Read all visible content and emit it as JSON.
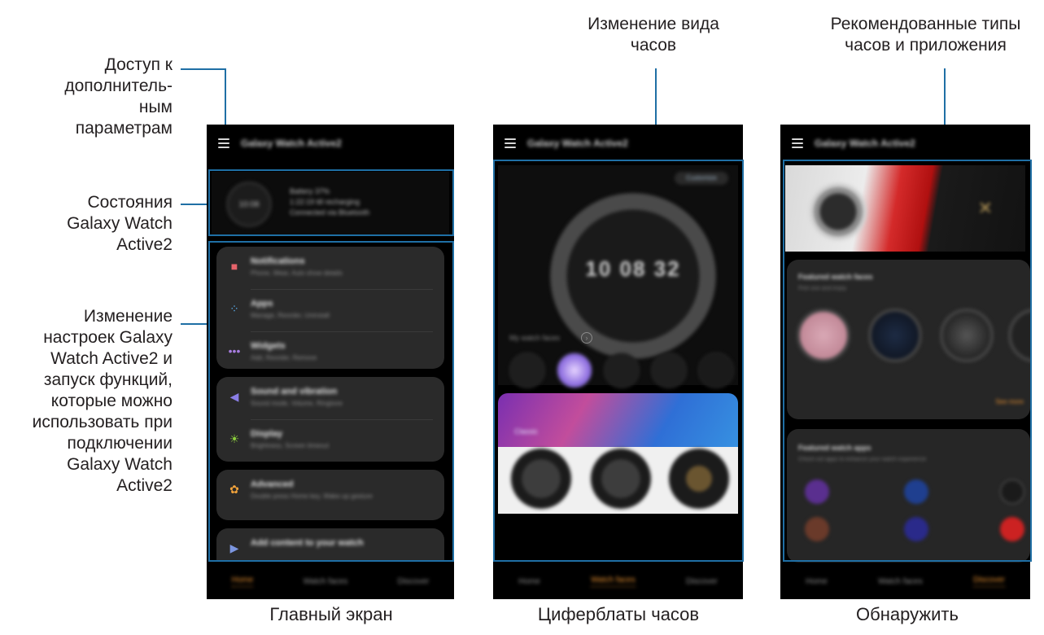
{
  "callouts": {
    "more_options": "Доступ к\nдополнитель-\nным параметрам",
    "watch_status": "Состояния\nGalaxy Watch\nActive2",
    "settings": "Изменение\nнастроек Galaxy\nWatch Active2 и\nзапуск функций,\nкоторые можно\nиспользовать при\nподключении\nGalaxy Watch\nActive2",
    "change_watch": "Изменение вида\nчасов",
    "recommended": "Рекомендованные типы\nчасов и приложения"
  },
  "captions": {
    "home": "Главный экран",
    "watch_faces": "Циферблаты часов",
    "discover": "Обнаружить"
  },
  "colors": {
    "accent_line": "#1f6fa5",
    "active_tab": "#e8902f"
  },
  "icons": [
    "menu-icon",
    "notifications-icon",
    "apps-icon",
    "widgets-icon",
    "sound-icon",
    "display-icon",
    "advanced-icon",
    "add-content-icon",
    "chevron-right-icon"
  ]
}
